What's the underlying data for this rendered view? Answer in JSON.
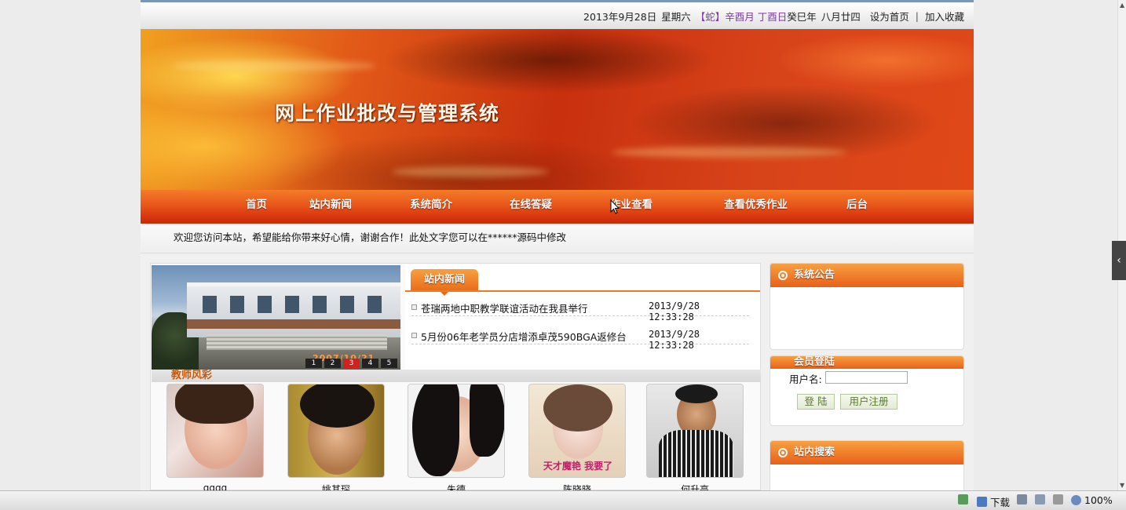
{
  "topbar": {
    "date": "2013年9月28日",
    "weekday": "星期六",
    "lunar": "【蛇】辛酉月 丁酉日",
    "year": "癸巳年",
    "lunar_day": "八月廿四",
    "set_home": "设为首页",
    "separator": "|",
    "add_fav": "加入收藏"
  },
  "banner": {
    "title": "网上作业批改与管理系统"
  },
  "nav": {
    "items": [
      "首页",
      "站内新闻",
      "系统简介",
      "在线答疑",
      "作业查看",
      "查看优秀作业",
      "后台"
    ]
  },
  "marquee": {
    "text": "欢迎您访问本站，希望能给你带来好心情，谢谢合作！此处文字您可以在******源码中修改"
  },
  "slideshow": {
    "stamp": "2007/10/21",
    "pages": [
      "1",
      "2",
      "3",
      "4",
      "5"
    ],
    "active_page": 3
  },
  "news": {
    "tab_label": "站内新闻",
    "items": [
      {
        "title": "苍瑞两地中职教学联谊活动在我县举行",
        "date": "2013/9/28 12:33:28"
      },
      {
        "title": "5月份06年老学员分店增添卓茂590BGA返修台",
        "date": "2013/9/28 12:33:28"
      }
    ]
  },
  "teachers": {
    "label": "教师风彩",
    "items": [
      {
        "name": "gggg",
        "caption": ""
      },
      {
        "name": "姚其琛",
        "caption": ""
      },
      {
        "name": "朱德",
        "caption": ""
      },
      {
        "name": "陈晓晓",
        "caption": "天才魔艳 我要了"
      },
      {
        "name": "何升高",
        "caption": ""
      }
    ]
  },
  "sidebar": {
    "notice_title": "系统公告",
    "member_title": "会员登陆",
    "username_label": "用户名:",
    "login_button": "登 陆",
    "register_button": "用户注册",
    "search_title": "站内搜索"
  },
  "statusbar": {
    "download": "下载",
    "zoom": "100%"
  },
  "colors": {
    "accent": "#e8601a",
    "nav": "#d8360e",
    "lunar_text": "#7a3aa6"
  },
  "sidetab": {
    "glyph": "‹"
  }
}
